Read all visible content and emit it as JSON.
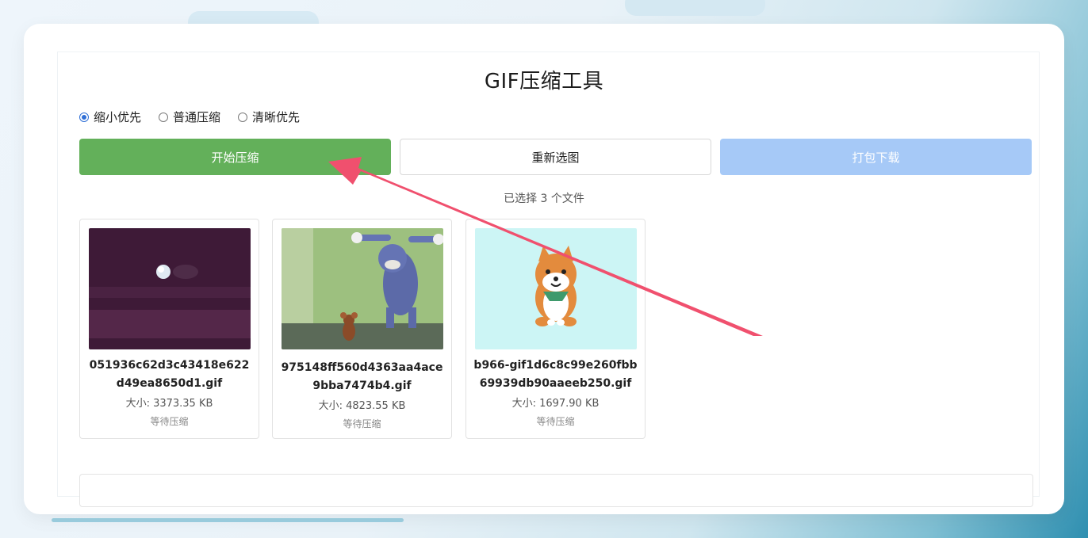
{
  "app": {
    "title": "GIF压缩工具"
  },
  "modes": [
    {
      "label": "缩小优先",
      "checked": true
    },
    {
      "label": "普通压缩",
      "checked": false
    },
    {
      "label": "清晰优先",
      "checked": false
    }
  ],
  "buttons": {
    "start": "开始压缩",
    "reselect": "重新选图",
    "download": "打包下载"
  },
  "selection_info": "已选择 3 个文件",
  "files": [
    {
      "name": "051936c62d3c43418e622d49ea8650d1.gif",
      "size": "大小: 3373.35 KB",
      "status": "等待压缩"
    },
    {
      "name": "975148ff560d4363aa4ace9bba7474b4.gif",
      "size": "大小: 4823.55 KB",
      "status": "等待压缩"
    },
    {
      "name": "b966-gif1d6c8c99e260fbb69939db90aaeeb250.gif",
      "size": "大小: 1697.90 KB",
      "status": "等待压缩"
    }
  ],
  "colors": {
    "start": "#63b05a",
    "download_disabled": "#a6c9f7",
    "radio_accent": "#2f6fd6",
    "arrow": "#f0506e"
  }
}
